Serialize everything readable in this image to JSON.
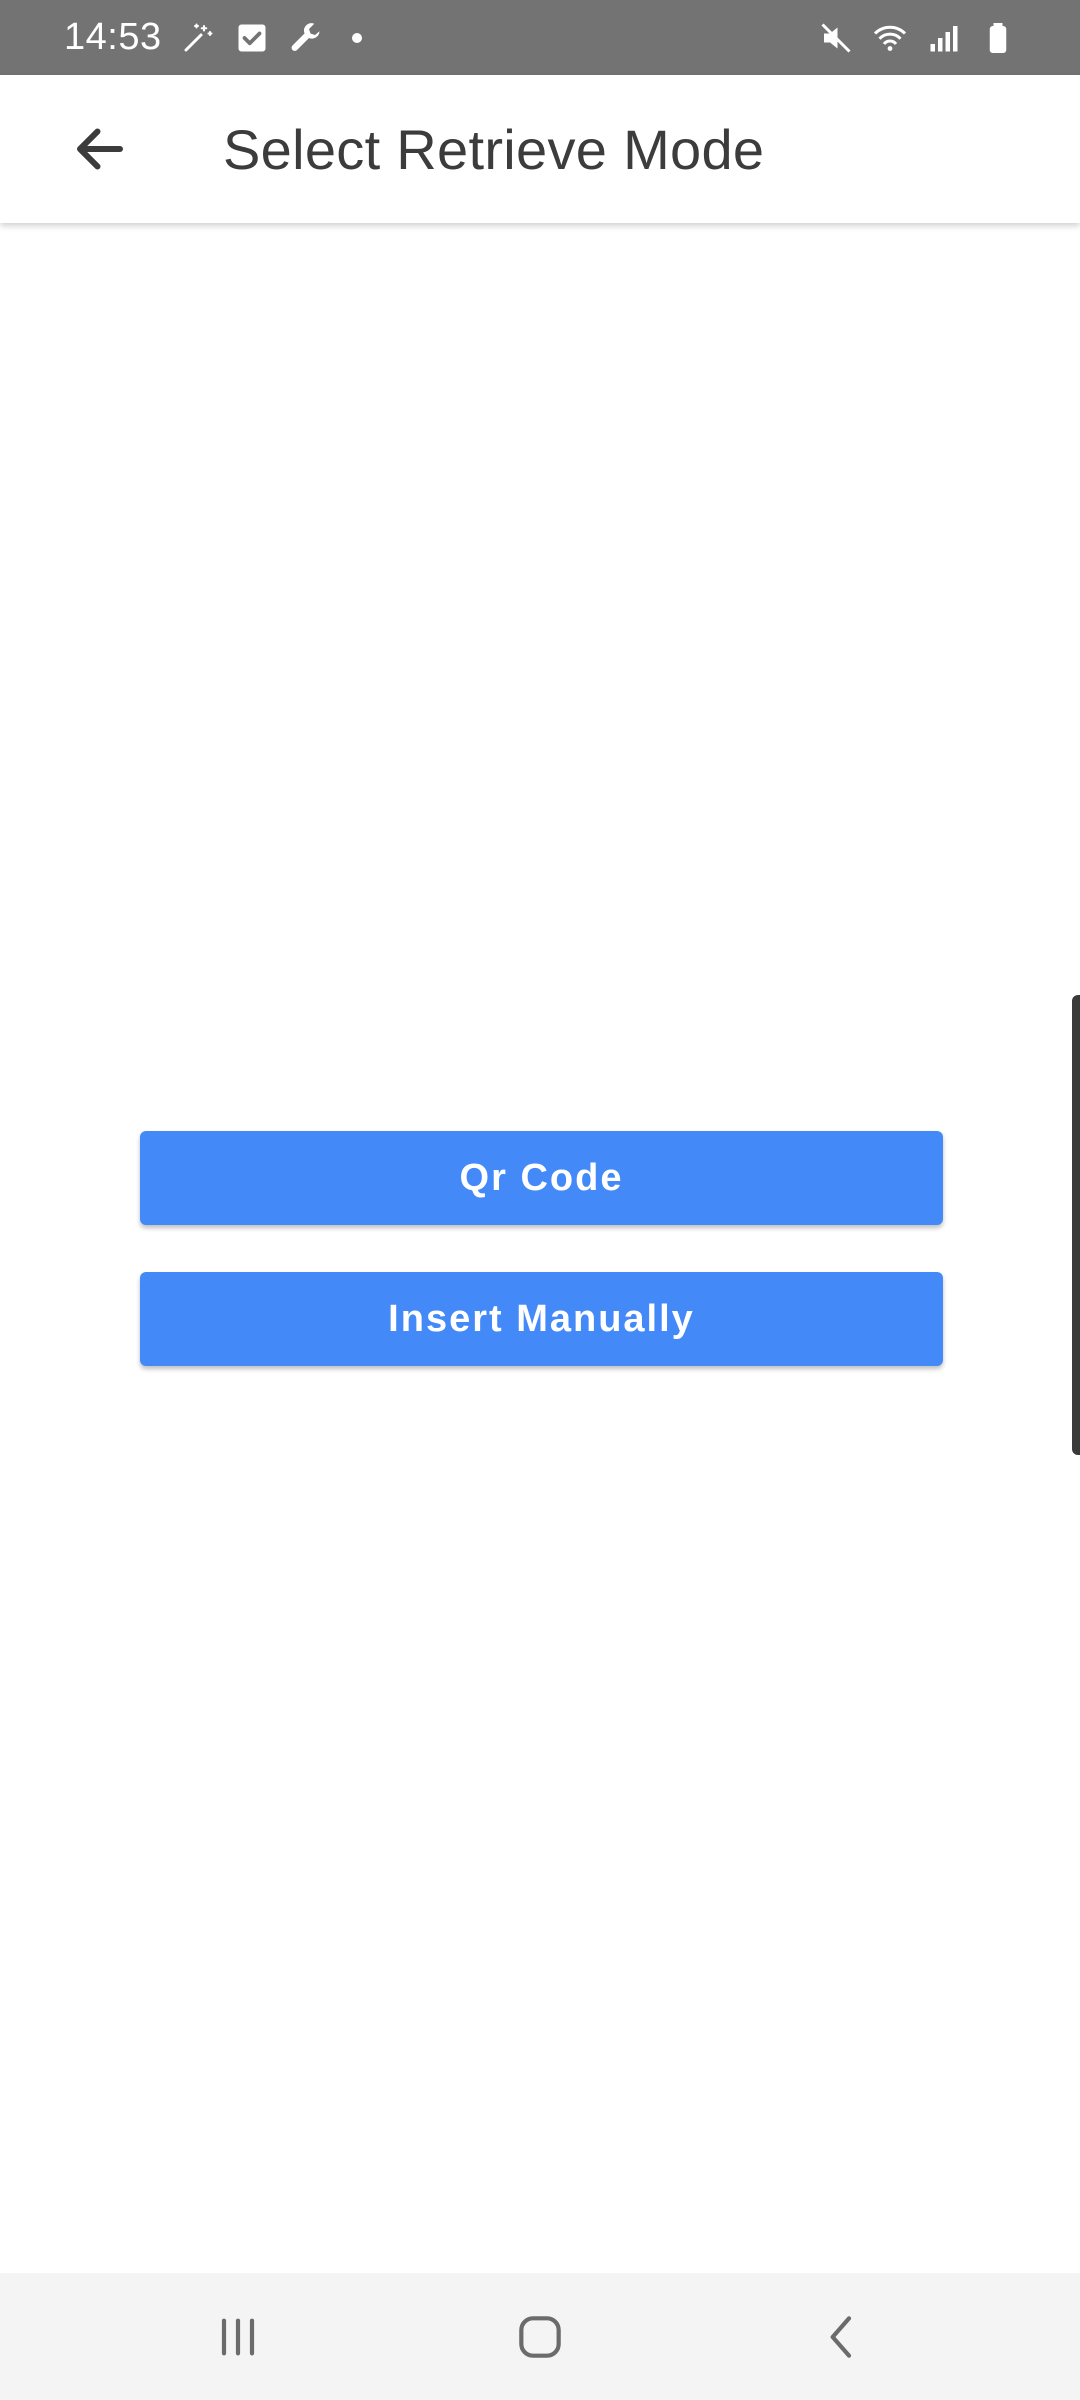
{
  "status_bar": {
    "time": "14:53",
    "left_icons": [
      "magic-wand-icon",
      "checkbox-icon",
      "wrench-icon",
      "notification-dot-icon"
    ],
    "right_icons": [
      "mute-icon",
      "wifi-icon",
      "signal-icon",
      "battery-icon"
    ]
  },
  "app_bar": {
    "title": "Select Retrieve Mode",
    "back_icon": "arrow-back-icon"
  },
  "main": {
    "buttons": [
      {
        "label": "Qr Code"
      },
      {
        "label": "Insert Manually"
      }
    ]
  },
  "nav_bar": {
    "icons": [
      "recent-apps-icon",
      "home-icon",
      "back-icon"
    ]
  },
  "colors": {
    "status_bar_bg": "#737373",
    "button_primary": "#438af8",
    "title_text": "#3c3c3c",
    "nav_bar_bg": "#f4f4f4"
  }
}
